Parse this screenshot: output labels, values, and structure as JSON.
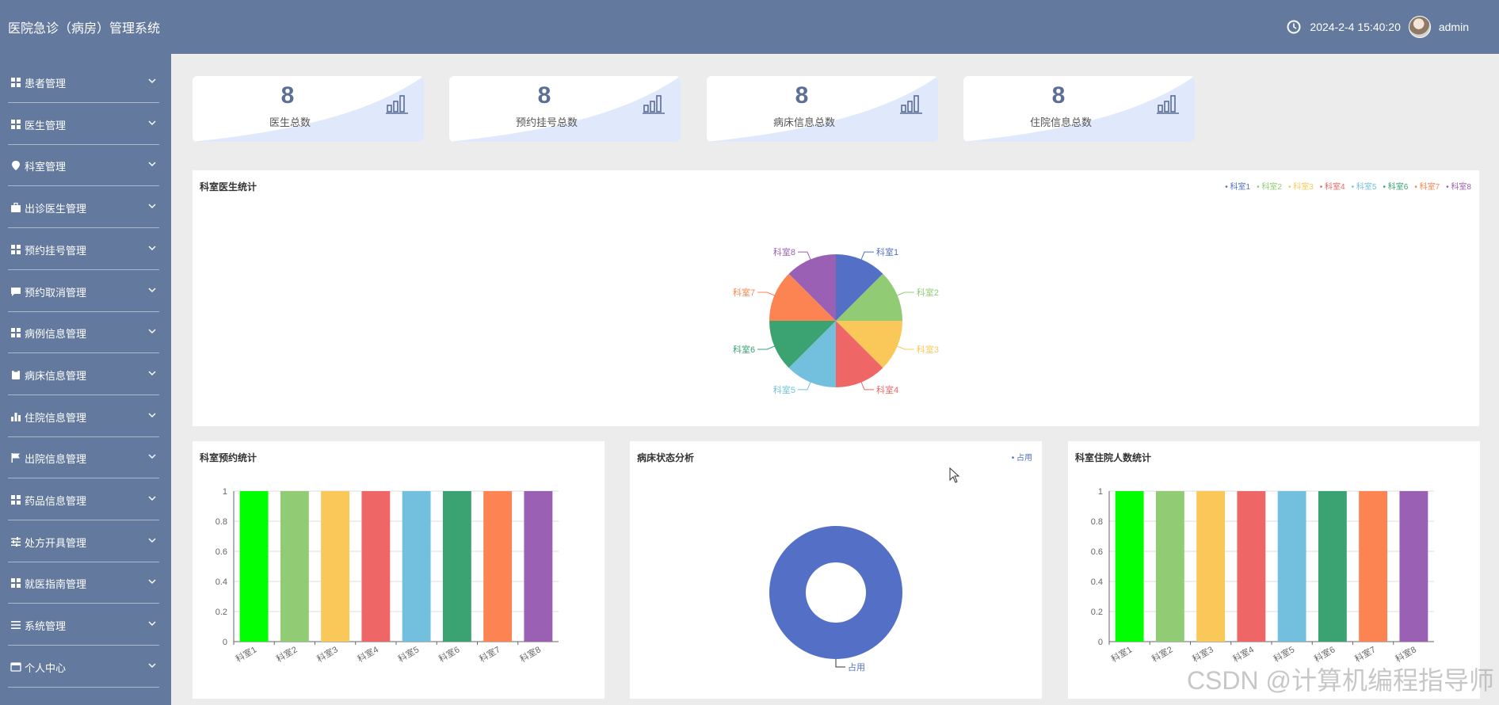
{
  "app": {
    "title": "医院急诊（病房）管理系统"
  },
  "header": {
    "datetime": "2024-2-4 15:40:20",
    "username": "admin",
    "clock_icon": "clock-icon",
    "avatar_icon": "user-avatar"
  },
  "sidebar": {
    "items": [
      {
        "label": "患者管理",
        "icon": "grid-icon"
      },
      {
        "label": "医生管理",
        "icon": "grid-icon"
      },
      {
        "label": "科室管理",
        "icon": "location-pin-icon"
      },
      {
        "label": "出诊医生管理",
        "icon": "briefcase-icon"
      },
      {
        "label": "预约挂号管理",
        "icon": "grid-icon"
      },
      {
        "label": "预约取消管理",
        "icon": "chat-icon"
      },
      {
        "label": "病例信息管理",
        "icon": "grid-icon"
      },
      {
        "label": "病床信息管理",
        "icon": "clipboard-icon"
      },
      {
        "label": "住院信息管理",
        "icon": "bar-chart-icon"
      },
      {
        "label": "出院信息管理",
        "icon": "flag-icon"
      },
      {
        "label": "药品信息管理",
        "icon": "grid-icon"
      },
      {
        "label": "处方开具管理",
        "icon": "sliders-icon"
      },
      {
        "label": "就医指南管理",
        "icon": "grid-icon"
      },
      {
        "label": "系统管理",
        "icon": "list-icon"
      },
      {
        "label": "个人中心",
        "icon": "window-icon"
      }
    ]
  },
  "stats": [
    {
      "value": "8",
      "label": "医生总数"
    },
    {
      "value": "8",
      "label": "预约挂号总数"
    },
    {
      "value": "8",
      "label": "病床信息总数"
    },
    {
      "value": "8",
      "label": "住院信息总数"
    }
  ],
  "colors": {
    "accent": "#63799e",
    "palette": [
      "#00ff00",
      "#91cc75",
      "#fac858",
      "#ee6666",
      "#73c0de",
      "#3ba272",
      "#fc8452",
      "#9a60b4"
    ],
    "pie_palette": [
      "#5470c6",
      "#91cc75",
      "#fac858",
      "#ee6666",
      "#73c0de",
      "#3ba272",
      "#fc8452",
      "#9a60b4"
    ]
  },
  "watermark": "CSDN @计算机编程指导师",
  "chart_data": [
    {
      "type": "pie",
      "title": "科室医生统计",
      "legend_position": "top-right",
      "categories": [
        "科室1",
        "科室2",
        "科室3",
        "科室4",
        "科室5",
        "科室6",
        "科室7",
        "科室8"
      ],
      "values": [
        1,
        1,
        1,
        1,
        1,
        1,
        1,
        1
      ]
    },
    {
      "type": "bar",
      "title": "科室预约统计",
      "categories": [
        "科室1",
        "科室2",
        "科室3",
        "科室4",
        "科室5",
        "科室6",
        "科室7",
        "科室8"
      ],
      "values": [
        1,
        1,
        1,
        1,
        1,
        1,
        1,
        1
      ],
      "yticks": [
        "0",
        "0.2",
        "0.4",
        "0.6",
        "0.8",
        "1"
      ],
      "ylim": [
        0,
        1
      ],
      "grid": true
    },
    {
      "type": "pie",
      "subtype": "donut",
      "title": "病床状态分析",
      "legend_position": "top-right",
      "categories": [
        "占用"
      ],
      "values": [
        1
      ]
    },
    {
      "type": "bar",
      "title": "科室住院人数统计",
      "categories": [
        "科室1",
        "科室2",
        "科室3",
        "科室4",
        "科室5",
        "科室6",
        "科室7",
        "科室8"
      ],
      "values": [
        1,
        1,
        1,
        1,
        1,
        1,
        1,
        1
      ],
      "yticks": [
        "0",
        "0.2",
        "0.4",
        "0.6",
        "0.8",
        "1"
      ],
      "ylim": [
        0,
        1
      ],
      "grid": true
    }
  ]
}
